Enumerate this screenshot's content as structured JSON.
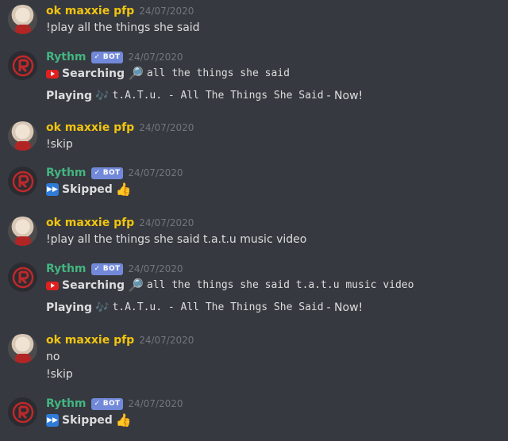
{
  "messages": [
    {
      "author": "ok maxxie pfp",
      "timestamp": "24/07/2020",
      "lines": [
        "!play all the things she said"
      ]
    },
    {
      "author": "Rythm",
      "bot_label": "✓ BOT",
      "timestamp": "24/07/2020",
      "searching_label": "Searching",
      "search_query": "all the things she said",
      "playing_label": "Playing",
      "track": "t.A.T.u. - All The Things She Said",
      "now_label": "- Now!"
    },
    {
      "author": "ok maxxie pfp",
      "timestamp": "24/07/2020",
      "lines": [
        "!skip"
      ]
    },
    {
      "author": "Rythm",
      "bot_label": "✓ BOT",
      "timestamp": "24/07/2020",
      "skipped_label": "Skipped"
    },
    {
      "author": "ok maxxie pfp",
      "timestamp": "24/07/2020",
      "lines": [
        "!play all the things she said t.a.t.u music video"
      ]
    },
    {
      "author": "Rythm",
      "bot_label": "✓ BOT",
      "timestamp": "24/07/2020",
      "searching_label": "Searching",
      "search_query": "all the things she said t.a.t.u music video",
      "playing_label": "Playing",
      "track": "t.A.T.u. - All The Things She Said",
      "now_label": "- Now!"
    },
    {
      "author": "ok maxxie pfp",
      "timestamp": "24/07/2020",
      "lines": [
        "no",
        "!skip"
      ]
    },
    {
      "author": "Rythm",
      "bot_label": "✓ BOT",
      "timestamp": "24/07/2020",
      "skipped_label": "Skipped"
    }
  ],
  "icons": {
    "youtube": "youtube-icon",
    "magnifier": "magnifying-glass-icon",
    "note": "music-note-icon",
    "fast_forward": "fast-forward-icon",
    "thumbs_up": "thumbs-up-icon"
  },
  "colors": {
    "background": "#36393f",
    "user_name": "#f1c40f",
    "bot_name": "#43b581",
    "bot_tag": "#7289da"
  }
}
